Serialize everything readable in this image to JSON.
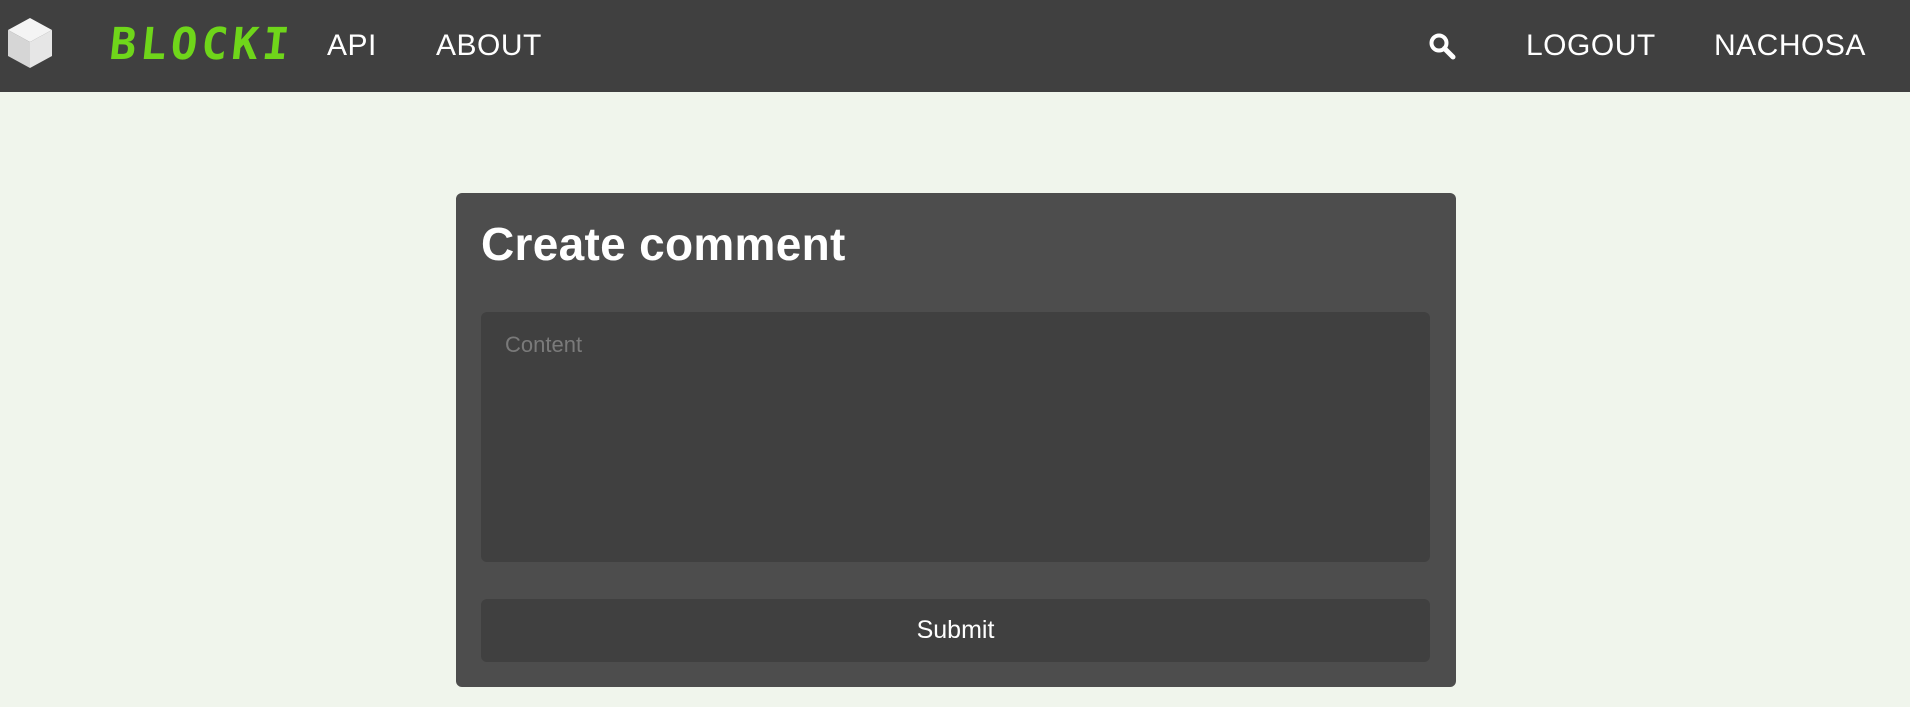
{
  "navbar": {
    "brand": "BLOCKI",
    "brand_color": "#6fd61a",
    "background": "#404040",
    "logo_icon": "cube-icon",
    "links": {
      "api": "API",
      "about": "ABOUT",
      "logout": "LOGOUT",
      "user": "NACHOSA"
    },
    "search_icon": "search-icon"
  },
  "page": {
    "background": "#f0f5ec"
  },
  "form": {
    "title": "Create comment",
    "content_placeholder": "Content",
    "content_value": "",
    "submit_label": "Submit",
    "card_background": "#4d4d4d",
    "field_background": "#404040"
  }
}
